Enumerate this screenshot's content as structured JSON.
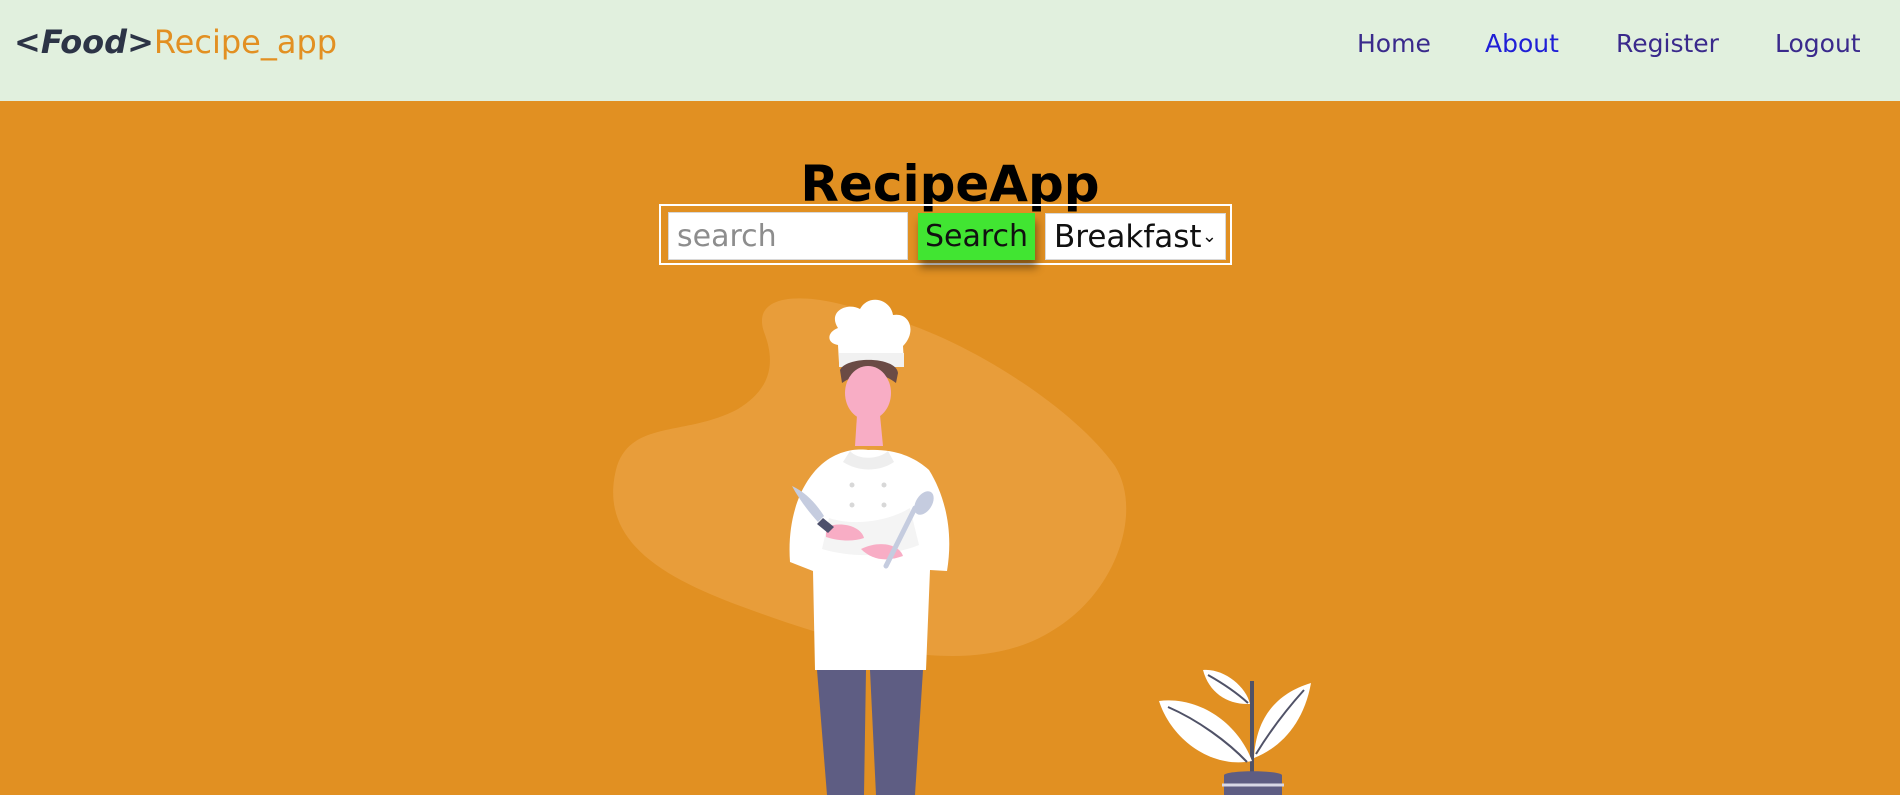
{
  "navbar": {
    "brand": {
      "tag": "<Food>",
      "name": "Recipe_app"
    },
    "links": [
      {
        "label": "Home"
      },
      {
        "label": "About"
      },
      {
        "label": "Register"
      },
      {
        "label": "Logout"
      }
    ]
  },
  "hero": {
    "title": "RecipeApp",
    "search": {
      "placeholder": "search",
      "button_label": "Search",
      "selected_category": "Breakfast"
    },
    "illustration": {
      "figure": "chef-with-knife-and-spoon",
      "decoration": "plant-in-pot"
    }
  },
  "colors": {
    "navbar_background": "#e1f0de",
    "hero_background": "#e19022",
    "brand_tag": "#2c3446",
    "brand_name": "#e29022",
    "nav_link": "#3a2a8c",
    "active_nav_link": "#1f1fd6",
    "search_button": "#41e532"
  }
}
